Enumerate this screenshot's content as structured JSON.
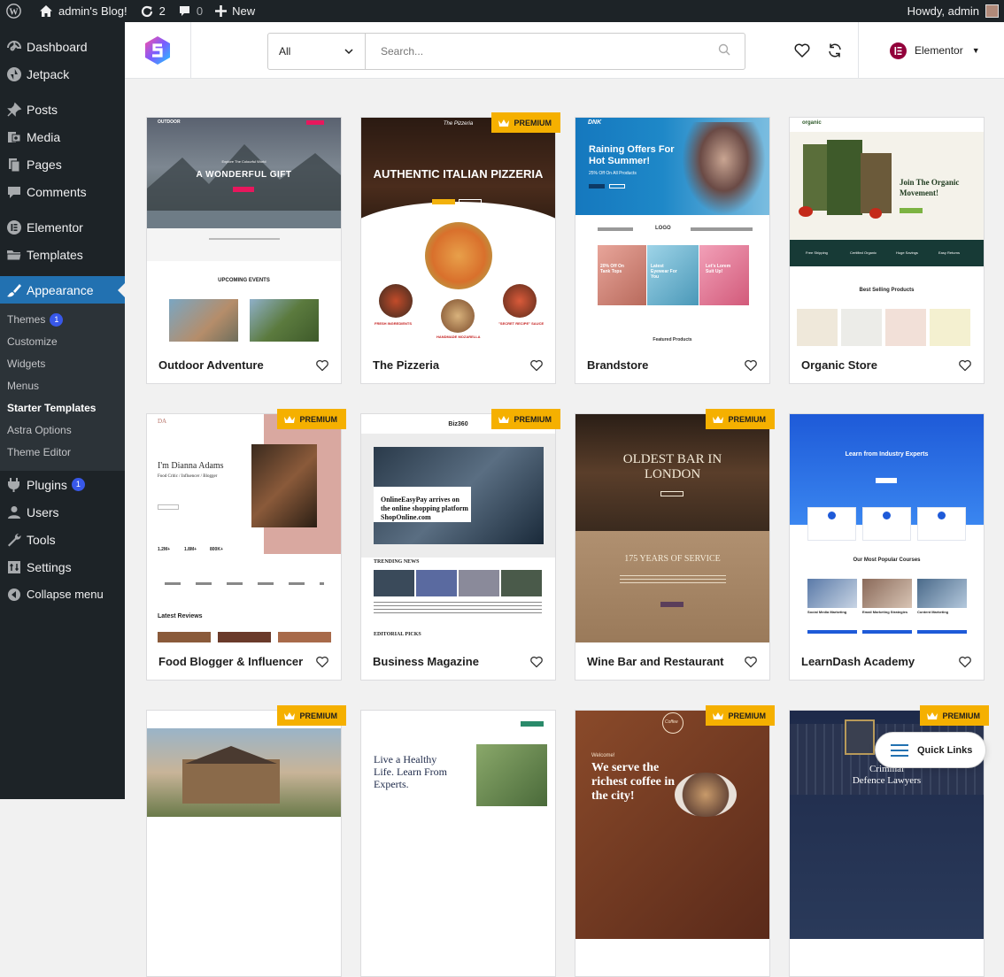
{
  "admin_bar": {
    "site_name": "admin's Blog!",
    "updates_count": "2",
    "comments_count": "0",
    "new_label": "New",
    "greeting": "Howdy, admin"
  },
  "sidebar": {
    "items": [
      {
        "label": "Dashboard",
        "icon": "dashboard-icon"
      },
      {
        "label": "Jetpack",
        "icon": "jetpack-icon"
      },
      {
        "label": "Posts",
        "icon": "pin-icon"
      },
      {
        "label": "Media",
        "icon": "media-icon"
      },
      {
        "label": "Pages",
        "icon": "pages-icon"
      },
      {
        "label": "Comments",
        "icon": "comment-icon"
      },
      {
        "label": "Elementor",
        "icon": "elementor-icon"
      },
      {
        "label": "Templates",
        "icon": "folder-icon"
      },
      {
        "label": "Appearance",
        "icon": "brush-icon"
      }
    ],
    "appearance_sub": [
      {
        "label": "Themes",
        "badge": "1"
      },
      {
        "label": "Customize"
      },
      {
        "label": "Widgets"
      },
      {
        "label": "Menus"
      },
      {
        "label": "Starter Templates"
      },
      {
        "label": "Astra Options"
      },
      {
        "label": "Theme Editor"
      }
    ],
    "lower_items": [
      {
        "label": "Plugins",
        "badge": "1",
        "icon": "plugin-icon"
      },
      {
        "label": "Users",
        "icon": "user-icon"
      },
      {
        "label": "Tools",
        "icon": "wrench-icon"
      },
      {
        "label": "Settings",
        "icon": "settings-icon"
      },
      {
        "label": "Collapse menu",
        "icon": "collapse-icon"
      }
    ]
  },
  "topbar": {
    "filter_value": "All",
    "search_placeholder": "Search...",
    "builder_label": "Elementor"
  },
  "premium_label": "PREMIUM",
  "templates": [
    {
      "name": "Outdoor Adventure",
      "premium": false
    },
    {
      "name": "The Pizzeria",
      "premium": true
    },
    {
      "name": "Brandstore",
      "premium": false
    },
    {
      "name": "Organic Store",
      "premium": false
    },
    {
      "name": "Food Blogger & Influencer",
      "premium": true
    },
    {
      "name": "Business Magazine",
      "premium": true
    },
    {
      "name": "Wine Bar and Restaurant",
      "premium": true
    },
    {
      "name": "LearnDash Academy",
      "premium": false
    },
    {
      "name": "",
      "premium": true
    },
    {
      "name": "",
      "premium": false
    },
    {
      "name": "",
      "premium": true
    },
    {
      "name": "",
      "premium": true
    }
  ],
  "thumb_text": {
    "outdoor": {
      "brand": "OUTDOOR",
      "tag": "Explore The Colourful World",
      "hero": "A WONDERFUL GIFT",
      "section": "UPCOMING EVENTS"
    },
    "pizzeria": {
      "brand": "The Pizzeria",
      "hero": "AUTHENTIC ITALIAN PIZZERIA",
      "l1": "FRESH INGREDIENTS",
      "l2": "HANDMADE MOZARELLA",
      "l3": "\"SECRET RECIPE\" SAUCE"
    },
    "brandstore": {
      "brand": "DNK",
      "hero1": "Raining Offers For",
      "hero2": "Hot Summer!",
      "sub": "25% Off On All Products",
      "logo": "LOGO",
      "p1": "20% Off On Tank Tops",
      "p2": "Latest Eyewear For You",
      "p3": "Let's Lorem Suit Up!",
      "section": "Featured Products"
    },
    "organic": {
      "brand": "organic",
      "hero1": "Join The Organic",
      "hero2": "Movement!",
      "section": "Best Selling Products",
      "f1": "Free Shipping",
      "f2": "Certified Organic",
      "f3": "Huge Savings",
      "f4": "Easy Returns"
    },
    "food": {
      "brand": "DA",
      "hero1": "I'm Dianna Adams",
      "hero2": "Food Critic / Influencer / Blogger",
      "s1": "1.2M+",
      "s2": "1.8M+",
      "s3": "800K+",
      "section": "Latest Reviews"
    },
    "magazine": {
      "brand": "Biz360",
      "hero1": "OnlineEasyPay arrives on",
      "hero2": "the online shopping platform",
      "hero3": "ShopOnline.com",
      "sec1": "TRENDING NEWS",
      "sec2": "EDITORIAL PICKS"
    },
    "winebar": {
      "hero1": "OLDEST BAR IN",
      "hero2": "LONDON",
      "sub": "175 YEARS OF SERVICE"
    },
    "learndash": {
      "hero": "Learn from Industry Experts",
      "section": "Our Most Popular Courses",
      "c1": "Social Media Marketing",
      "c2": "Email Marketing Strategies",
      "c3": "Content Marketing"
    },
    "healthy": {
      "hero1": "Live a Healthy",
      "hero2": "Life. Learn From",
      "hero3": "Experts."
    },
    "coffee": {
      "brand": "Coffee",
      "welcome": "Welcome!",
      "hero1": "We serve the",
      "hero2": "richest coffee in",
      "hero3": "the city!"
    },
    "lawyers": {
      "hero1": "Criminal",
      "hero2": "Defence Lawyers"
    }
  },
  "quick_links_label": "Quick Links",
  "colors": {
    "accent": "#2271b1",
    "premium": "#f5b000",
    "admin_bg": "#1d2327"
  }
}
